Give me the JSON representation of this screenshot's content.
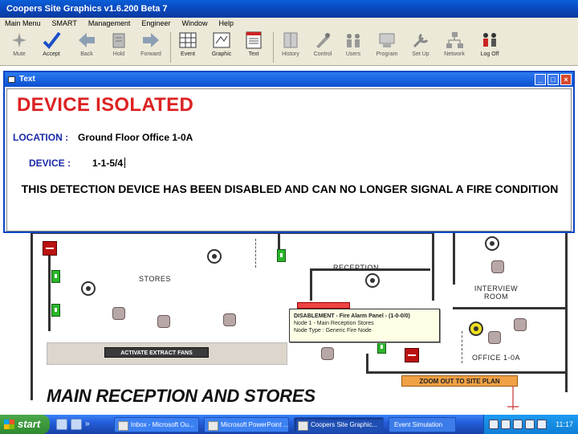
{
  "window": {
    "title": "Coopers Site Graphics   v1.6.200   Beta 7"
  },
  "menu": [
    "Main Menu",
    "SMART",
    "Management",
    "Engineer",
    "Window",
    "Help"
  ],
  "toolbar": [
    {
      "label": "Mute",
      "icon": "mute-icon",
      "enabled": false
    },
    {
      "label": "Accept",
      "icon": "accept-check-icon",
      "enabled": true
    },
    {
      "label": "Back",
      "icon": "back-arrow-icon",
      "enabled": false
    },
    {
      "label": "Hold",
      "icon": "hold-icon",
      "enabled": false
    },
    {
      "label": "Forward",
      "icon": "forward-arrow-icon",
      "enabled": false
    },
    {
      "label": "Event",
      "icon": "event-grid-icon",
      "enabled": true
    },
    {
      "label": "Graphic",
      "icon": "graphic-icon",
      "enabled": true
    },
    {
      "label": "Text",
      "icon": "text-icon",
      "enabled": true
    },
    {
      "label": "History",
      "icon": "history-icon",
      "enabled": false
    },
    {
      "label": "Control",
      "icon": "control-icon",
      "enabled": false
    },
    {
      "label": "Users",
      "icon": "users-icon",
      "enabled": false
    },
    {
      "label": "Program",
      "icon": "program-icon",
      "enabled": false
    },
    {
      "label": "Set Up",
      "icon": "setup-icon",
      "enabled": false
    },
    {
      "label": "Network",
      "icon": "network-icon",
      "enabled": false
    },
    {
      "label": "Log Off",
      "icon": "log-off-icon",
      "enabled": true
    }
  ],
  "text_window": {
    "title": "Text",
    "heading": "DEVICE ISOLATED",
    "location_label": "LOCATION :",
    "location_value": "Ground Floor Office 1-0A",
    "device_label": "DEVICE :",
    "device_value": "1-1-5/4",
    "message": "THIS DETECTION DEVICE HAS BEEN DISABLED AND CAN NO LONGER SIGNAL A FIRE CONDITION",
    "controls": [
      "_",
      "□",
      "×"
    ]
  },
  "floor_plan": {
    "title": "MAIN RECEPTION AND STORES",
    "rooms": [
      "STORES",
      "RECEPTION",
      "INTERVIEW ROOM",
      "OFFICE 1-0A"
    ],
    "extract_button": "ACTIVATE EXTRACT FANS",
    "zoom_button": "ZOOM OUT TO SITE PLAN"
  },
  "tooltip": {
    "line1": "DISABLEMENT - Fire Alarm Panel - (1-0-0/0)",
    "line2": "Node 1 - Main Reception Stores",
    "line3": "Node Type : Generic Fire Node"
  },
  "taskbar": {
    "start": "start",
    "tasks": [
      {
        "label": "Inbox - Microsoft Ou...",
        "active": false
      },
      {
        "label": "Microsoft PowerPoint ...",
        "active": false
      },
      {
        "label": "Coopers Site Graphic...",
        "active": true
      },
      {
        "label": "Event Simulation",
        "active": false
      }
    ],
    "clock": "11:17"
  },
  "colors": {
    "heading": "#d22222",
    "label_blue": "#1b2aa8",
    "titlebar": "#0a46c4",
    "zoom_button": "#f0a045"
  }
}
